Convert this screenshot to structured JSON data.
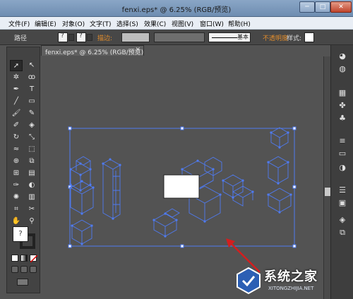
{
  "window": {
    "title": "fenxi.eps* @ 6.25% (RGB/预览)",
    "minimize_label": "─",
    "maximize_label": "□",
    "close_label": "✕"
  },
  "menubar": {
    "items": [
      {
        "label": "文件(F)"
      },
      {
        "label": "编辑(E)"
      },
      {
        "label": "对象(O)"
      },
      {
        "label": "文字(T)"
      },
      {
        "label": "选择(S)"
      },
      {
        "label": "效果(C)"
      },
      {
        "label": "视图(V)"
      },
      {
        "label": "窗口(W)"
      },
      {
        "label": "帮助(H)"
      }
    ]
  },
  "controlbar": {
    "selection_label": "路径",
    "fill_glyph": "?",
    "stroke_glyph": "?",
    "stroke_label": "描边:",
    "stroke_style_label": "基本",
    "opacity_label": "不透明度",
    "style_label": "样式:"
  },
  "document_tab": {
    "label": "fenxi.eps* @ 6.25% (RGB/预览)",
    "close_glyph": "✕"
  },
  "tools": [
    {
      "name": "selection-tool-icon",
      "glyph": "➚"
    },
    {
      "name": "direct-selection-tool-icon",
      "glyph": "↖"
    },
    {
      "name": "magic-wand-tool-icon",
      "glyph": "✲"
    },
    {
      "name": "lasso-tool-icon",
      "glyph": "ꝏ"
    },
    {
      "name": "pen-tool-icon",
      "glyph": "✒"
    },
    {
      "name": "type-tool-icon",
      "glyph": "T"
    },
    {
      "name": "line-tool-icon",
      "glyph": "╱"
    },
    {
      "name": "rectangle-tool-icon",
      "glyph": "▭"
    },
    {
      "name": "paintbrush-tool-icon",
      "glyph": "🖌"
    },
    {
      "name": "pencil-tool-icon",
      "glyph": "✎"
    },
    {
      "name": "blob-brush-tool-icon",
      "glyph": "✐"
    },
    {
      "name": "eraser-tool-icon",
      "glyph": "◈"
    },
    {
      "name": "rotate-tool-icon",
      "glyph": "↻"
    },
    {
      "name": "scale-tool-icon",
      "glyph": "⤡"
    },
    {
      "name": "warp-tool-icon",
      "glyph": "≈"
    },
    {
      "name": "free-transform-tool-icon",
      "glyph": "⬚"
    },
    {
      "name": "shape-builder-tool-icon",
      "glyph": "⊕"
    },
    {
      "name": "perspective-grid-tool-icon",
      "glyph": "⧉"
    },
    {
      "name": "mesh-tool-icon",
      "glyph": "⊞"
    },
    {
      "name": "gradient-tool-icon",
      "glyph": "▤"
    },
    {
      "name": "eyedropper-tool-icon",
      "glyph": "✑"
    },
    {
      "name": "blend-tool-icon",
      "glyph": "◐"
    },
    {
      "name": "symbol-sprayer-tool-icon",
      "glyph": "✺"
    },
    {
      "name": "column-graph-tool-icon",
      "glyph": "▥"
    },
    {
      "name": "artboard-tool-icon",
      "glyph": "⌗"
    },
    {
      "name": "slice-tool-icon",
      "glyph": "✂"
    },
    {
      "name": "hand-tool-icon",
      "glyph": "✋"
    },
    {
      "name": "zoom-tool-icon",
      "glyph": "⚲"
    }
  ],
  "fill_stroke": {
    "fill_glyph": "?"
  },
  "right_panel_icons": [
    {
      "name": "color-guide-icon",
      "glyph": "◕"
    },
    {
      "name": "color-icon",
      "glyph": "◍"
    },
    {
      "name": "swatches-icon",
      "glyph": "▦"
    },
    {
      "name": "brushes-icon",
      "glyph": "✤"
    },
    {
      "name": "symbols-icon",
      "glyph": "♣"
    },
    {
      "name": "stroke-icon",
      "glyph": "≡"
    },
    {
      "name": "gradient-icon",
      "glyph": "▭"
    },
    {
      "name": "transparency-icon",
      "glyph": "◑"
    },
    {
      "name": "appearance-icon",
      "glyph": "☰"
    },
    {
      "name": "graphic-styles-icon",
      "glyph": "▣"
    },
    {
      "name": "layers-icon",
      "glyph": "◈"
    },
    {
      "name": "artboards-icon",
      "glyph": "⧉"
    }
  ],
  "colors": {
    "selection_blue": "#4f7bf2",
    "annotation_red": "#d31f1f",
    "canvas_bg": "#535353"
  },
  "watermark": {
    "title": "系统之家",
    "subtitle": "XITONGZHIJIA.NET"
  }
}
